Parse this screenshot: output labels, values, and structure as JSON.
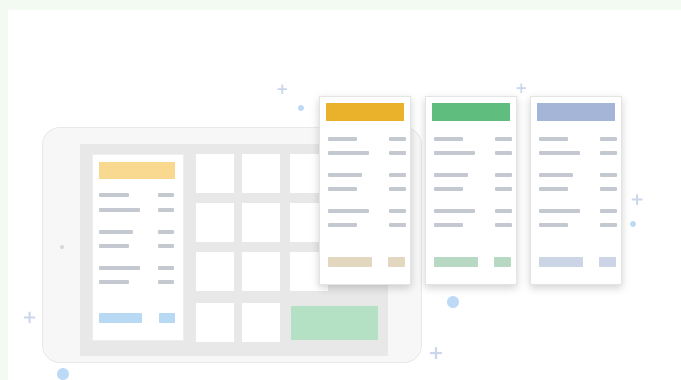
{
  "colors": {
    "background_tint": "#f3faf1",
    "placeholder_line": "#c4c9d1",
    "tablet_header": "#f8d98f",
    "tablet_footer": "#b7d9f4",
    "tablet_green_block": "#b4e0c3",
    "card_yellow": "#eab12b",
    "card_yellow_footer": "#e3d7c0",
    "card_green": "#5fbe7e",
    "card_green_footer": "#b7d8c2",
    "card_blue": "#a4b5d7",
    "card_blue_footer": "#ccd5e6",
    "decoration_dot": "#bcd9f6",
    "decoration_plus": "#c9d6ec"
  },
  "decorations": {
    "plus_glyph": "+"
  },
  "cards": [
    {
      "name": "yellow",
      "header_color_key": "card_yellow",
      "footer_color_key": "card_yellow_footer"
    },
    {
      "name": "green",
      "header_color_key": "card_green",
      "footer_color_key": "card_green_footer"
    },
    {
      "name": "blue",
      "header_color_key": "card_blue",
      "footer_color_key": "card_blue_footer"
    }
  ]
}
